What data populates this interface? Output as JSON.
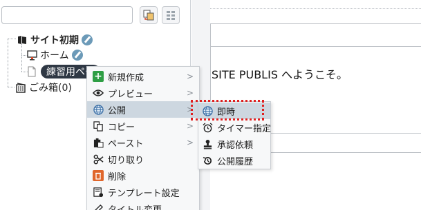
{
  "search": {
    "value": "",
    "placeholder": ""
  },
  "tree": {
    "site_root": "サイト初期",
    "home": "ホーム",
    "practice_page": "練習用ペー",
    "trash": "ごみ箱(0)"
  },
  "editor": {
    "welcome_text": "SITE PUBLIS へようこそ。"
  },
  "context_menu": {
    "items": [
      {
        "label": "新規作成",
        "icon": "plus-icon",
        "has_submenu": true
      },
      {
        "label": "プレビュー",
        "icon": "eye-icon",
        "has_submenu": true
      },
      {
        "label": "公開",
        "icon": "globe-icon",
        "has_submenu": true
      },
      {
        "label": "コピー",
        "icon": "copy-icon",
        "has_submenu": true
      },
      {
        "label": "ペースト",
        "icon": "paste-icon",
        "has_submenu": true
      },
      {
        "label": "切り取り",
        "icon": "scissors-icon",
        "has_submenu": false
      },
      {
        "label": "削除",
        "icon": "trash-icon",
        "has_submenu": false
      },
      {
        "label": "テンプレート設定",
        "icon": "template-icon",
        "has_submenu": false
      },
      {
        "label": "タイトル変更",
        "icon": "pencil-icon",
        "has_submenu": false
      }
    ],
    "submenu_arrow": ">"
  },
  "publish_submenu": {
    "items": [
      {
        "label": "即時",
        "icon": "globe-icon"
      },
      {
        "label": "タイマー指定",
        "icon": "alarm-clock-icon"
      },
      {
        "label": "承認依頼",
        "icon": "stamp-icon"
      },
      {
        "label": "公開履歴",
        "icon": "history-icon"
      }
    ]
  },
  "colors": {
    "highlight": "#e02020",
    "selected_item": "#2f3844",
    "active_menu_item": "#cdd7e0",
    "plus_icon": "#2e9e44"
  }
}
